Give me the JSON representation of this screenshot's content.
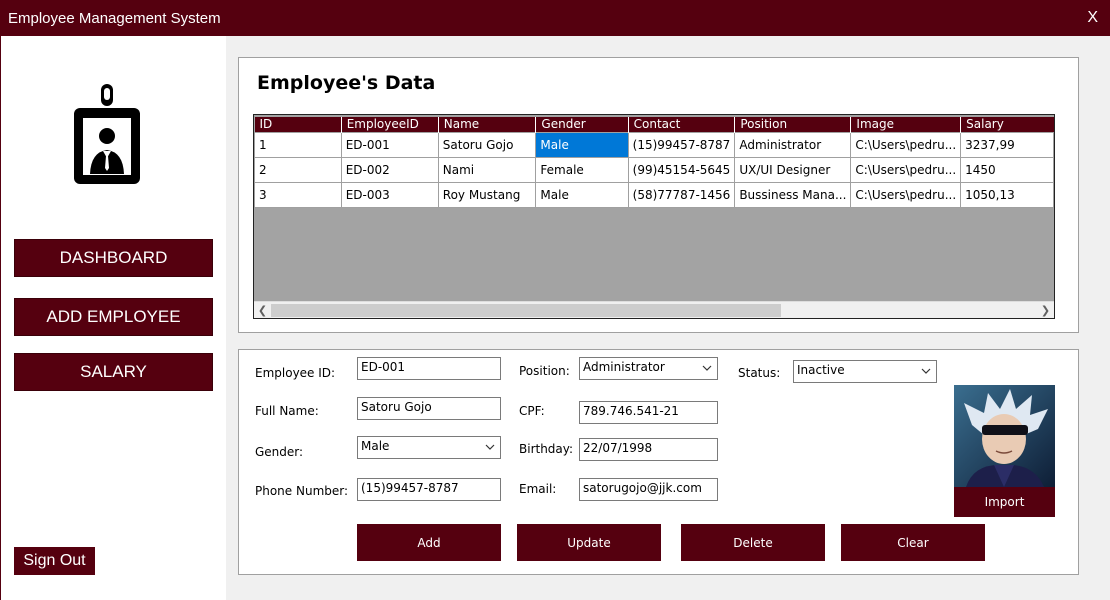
{
  "window": {
    "title": "Employee Management System",
    "close": "X"
  },
  "sidebar": {
    "icon": "employee-badge-icon",
    "nav": [
      {
        "label": "DASHBOARD"
      },
      {
        "label": "ADD EMPLOYEE"
      },
      {
        "label": "SALARY"
      }
    ],
    "signout_label": "Sign Out"
  },
  "data_panel": {
    "title": "Employee's Data",
    "columns": [
      "ID",
      "EmployeeID",
      "Name",
      "Gender",
      "Contact",
      "Position",
      "Image",
      "Salary"
    ],
    "rows": [
      [
        "1",
        "ED-001",
        "Satoru Gojo",
        "Male",
        "(15)99457-8787",
        "Administrator",
        "C:\\Users\\pedru...",
        "3237,99"
      ],
      [
        "2",
        "ED-002",
        "Nami",
        "Female",
        "(99)45154-5645",
        "UX/UI Designer",
        "C:\\Users\\pedru...",
        "1450"
      ],
      [
        "3",
        "ED-003",
        "Roy Mustang",
        "Male",
        "(58)77787-1456",
        "Bussiness Mana...",
        "C:\\Users\\pedru...",
        "1050,13"
      ]
    ],
    "selected_cell": {
      "row": 0,
      "col": 3
    }
  },
  "form": {
    "employee_id": {
      "label": "Employee ID:",
      "value": "ED-001"
    },
    "full_name": {
      "label": "Full Name:",
      "value": "Satoru Gojo"
    },
    "gender": {
      "label": "Gender:",
      "value": "Male"
    },
    "phone": {
      "label": "Phone Number:",
      "value": "(15)99457-8787"
    },
    "position": {
      "label": "Position:",
      "value": "Administrator"
    },
    "cpf": {
      "label": "CPF:",
      "value": "789.746.541-21"
    },
    "birthday": {
      "label": "Birthday:",
      "value": "22/07/1998"
    },
    "email": {
      "label": "Email:",
      "value": "satorugojo@jjk.com"
    },
    "status": {
      "label": "Status:",
      "value": "Inactive"
    },
    "import_label": "Import"
  },
  "actions": {
    "add": "Add",
    "update": "Update",
    "delete": "Delete",
    "clear": "Clear"
  },
  "colors": {
    "accent": "#55000f",
    "selection": "#0078d7",
    "grid_empty": "#a3a3a3"
  }
}
